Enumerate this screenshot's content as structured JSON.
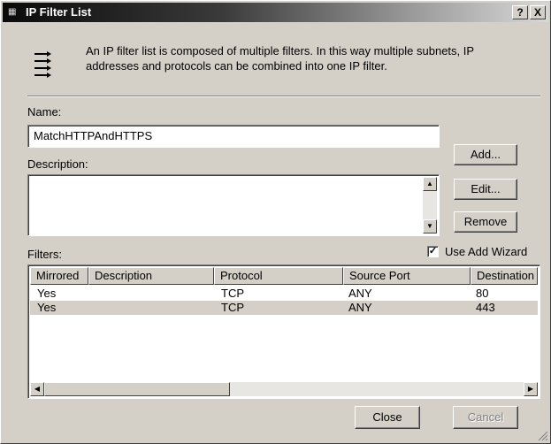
{
  "window": {
    "title": "IP Filter List",
    "help_label": "?",
    "close_label": "X"
  },
  "info": {
    "text": "An IP filter list is composed of multiple filters. In this way multiple subnets, IP addresses and protocols can be combined into one IP filter."
  },
  "name": {
    "label": "Name:",
    "value": "MatchHTTPAndHTTPS"
  },
  "description": {
    "label": "Description:",
    "value": ""
  },
  "buttons": {
    "add": "Add...",
    "edit": "Edit...",
    "remove": "Remove",
    "close": "Close",
    "cancel": "Cancel"
  },
  "filters": {
    "label": "Filters:",
    "use_add_wizard": "Use Add Wizard",
    "use_add_wizard_checked": true,
    "columns": [
      "Mirrored",
      "Description",
      "Protocol",
      "Source Port",
      "Destination"
    ],
    "rows": [
      {
        "mirrored": "Yes",
        "description": "",
        "protocol": "TCP",
        "source_port": "ANY",
        "destination": "80"
      },
      {
        "mirrored": "Yes",
        "description": "",
        "protocol": "TCP",
        "source_port": "ANY",
        "destination": "443"
      }
    ]
  }
}
